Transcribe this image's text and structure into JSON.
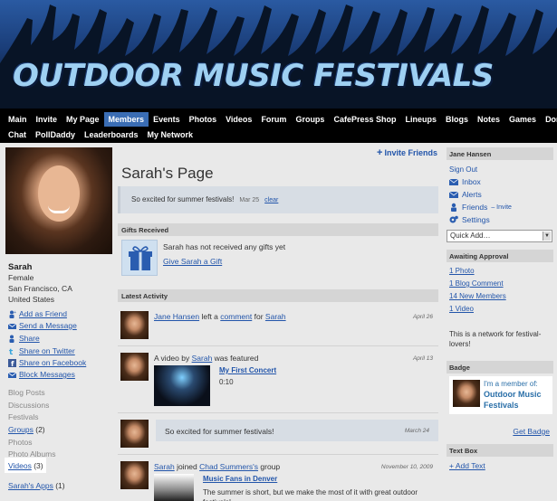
{
  "site": {
    "title": "OUTDOOR MUSIC FESTIVALS"
  },
  "nav": {
    "row1": [
      "Main",
      "Invite",
      "My Page",
      "Members",
      "Events",
      "Photos",
      "Videos",
      "Forum",
      "Groups",
      "CafePress Shop",
      "Lineups",
      "Blogs",
      "Notes",
      "Games",
      "Donate"
    ],
    "row2": [
      "Chat",
      "PollDaddy",
      "Leaderboards",
      "My Network"
    ],
    "active": "Members"
  },
  "profile": {
    "name": "Sarah",
    "gender": "Female",
    "city": "San Francisco, CA",
    "country": "United States",
    "actions": [
      {
        "label": "Add as Friend",
        "icon": "add-friend-icon"
      },
      {
        "label": "Send a Message",
        "icon": "mail-icon"
      },
      {
        "label": "Share",
        "icon": "share-icon"
      },
      {
        "label": "Share on Twitter",
        "icon": "twitter-icon"
      },
      {
        "label": "Share on Facebook",
        "icon": "facebook-icon"
      },
      {
        "label": "Block Messages",
        "icon": "block-icon"
      }
    ],
    "sections": {
      "blog_posts": "Blog Posts",
      "discussions": "Discussions",
      "festivals": "Festivals",
      "groups": "Groups",
      "groups_count": "(2)",
      "photos": "Photos",
      "photo_albums": "Photo Albums",
      "videos": "Videos",
      "videos_count": "(3)",
      "apps": "Sarah's Apps",
      "apps_count": "(1)"
    }
  },
  "main": {
    "invite_label": "Invite Friends",
    "page_title": "Sarah's Page",
    "status": {
      "text": "So excited for summer festivals!",
      "date": "Mar 25",
      "clear": "clear"
    },
    "gifts": {
      "header": "Gifts Received",
      "message": "Sarah has not received any gifts yet",
      "link": "Give Sarah a Gift"
    },
    "activity": {
      "header": "Latest Activity",
      "item1": {
        "actor": "Jane Hansen",
        "mid1": "left a",
        "link": "comment",
        "mid2": "for",
        "target": "Sarah",
        "date": "April 26"
      },
      "item2": {
        "prefix": "A video by",
        "actor": "Sarah",
        "suffix": "was featured",
        "date": "April 13",
        "video_title": "My First Concert",
        "duration": "0:10"
      },
      "item3": {
        "text": "So excited for summer festivals!",
        "date": "March 24"
      },
      "item4": {
        "actor": "Sarah",
        "mid": "joined",
        "owner": "Chad Summers's",
        "suffix": "group",
        "date": "November 10, 2009",
        "group_title": "Music Fans in Denver",
        "group_desc": "The summer is short, but we make the most of it with great outdoor festivals!"
      }
    }
  },
  "sidebar": {
    "user_name": "Jane Hansen",
    "sign_out": "Sign Out",
    "links": [
      {
        "label": "Inbox",
        "icon": "inbox-icon"
      },
      {
        "label": "Alerts",
        "icon": "alerts-icon"
      },
      {
        "label": "Friends",
        "icon": "friends-icon",
        "extra": "– Invite"
      },
      {
        "label": "Settings",
        "icon": "settings-icon"
      }
    ],
    "quick_add": "Quick Add…",
    "awaiting": {
      "header": "Awaiting Approval",
      "items": [
        "1 Photo",
        "1 Blog Comment",
        "14 New Members",
        "1 Video"
      ]
    },
    "network_note": "This is a network for festival-lovers!",
    "badge": {
      "header": "Badge",
      "line1": "I'm a member of:",
      "line2": "Outdoor Music",
      "line3": "Festivals",
      "get_badge": "Get Badge"
    },
    "textbox": {
      "header": "Text Box",
      "add": "+ Add Text"
    }
  },
  "colors": {
    "accent": "#2255aa",
    "nav_bg": "#000000",
    "nav_active": "#3a6db4",
    "banner_text": "#9ed0f2"
  }
}
